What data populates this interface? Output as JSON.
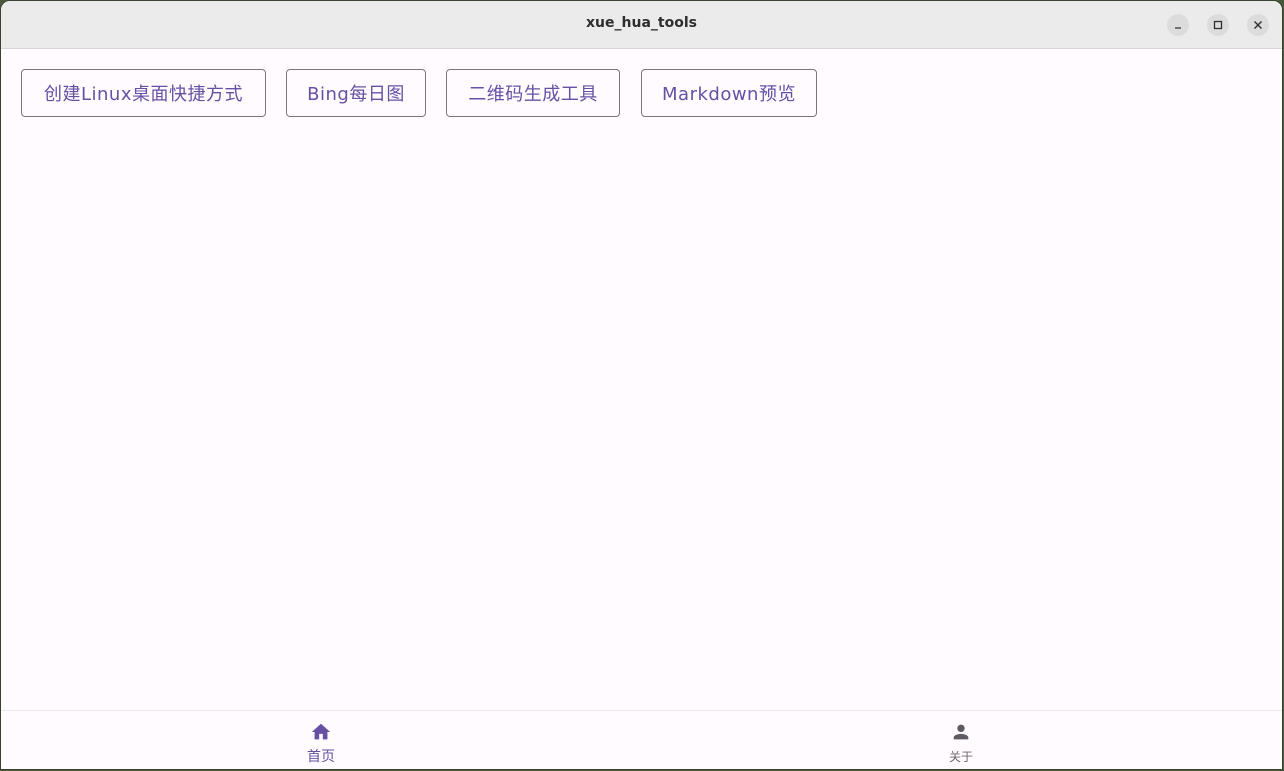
{
  "window": {
    "title": "xue_hua_tools",
    "controls": {
      "minimize_icon": "minimize-icon",
      "maximize_icon": "maximize-icon",
      "close_icon": "close-icon"
    }
  },
  "toolbar": {
    "buttons": [
      {
        "label": "创建Linux桌面快捷方式"
      },
      {
        "label": "Bing每日图"
      },
      {
        "label": "二维码生成工具"
      },
      {
        "label": "Markdown预览"
      }
    ]
  },
  "bottom_nav": {
    "items": [
      {
        "label": "首页",
        "icon": "home-icon",
        "selected": true
      },
      {
        "label": "关于",
        "icon": "person-icon",
        "selected": false
      }
    ]
  },
  "colors": {
    "accent": "#6750a4",
    "outline": "#7a757f",
    "background": "#fffbfe",
    "titlebar": "#ebebeb",
    "inactive": "#6c6870"
  }
}
